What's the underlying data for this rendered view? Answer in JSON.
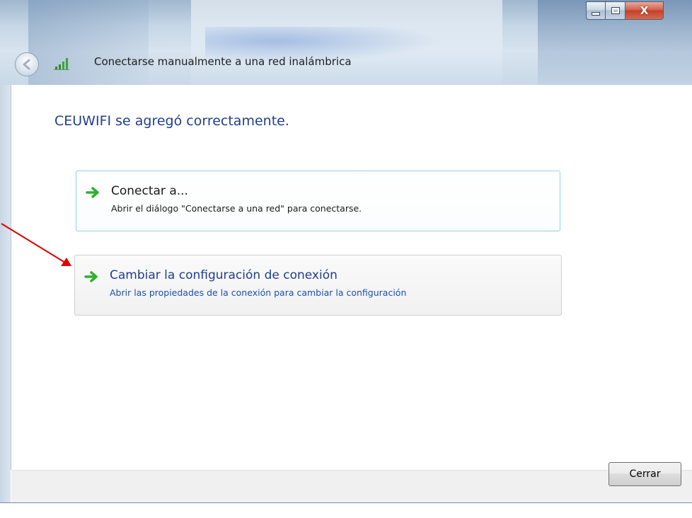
{
  "window": {
    "title": "Conectarse manualmente a una red inalámbrica",
    "caption_close": "X"
  },
  "main": {
    "heading": "CEUWIFI se agregó correctamente."
  },
  "options": [
    {
      "title": "Conectar a...",
      "description": "Abrir el diálogo \"Conectarse a una red\" para conectarse."
    },
    {
      "title": "Cambiar la configuración de conexión",
      "description": "Abrir las propiedades de la conexión para cambiar la configuración"
    }
  ],
  "footer": {
    "close_label": "Cerrar"
  },
  "colors": {
    "heading_blue": "#1e3f8f",
    "link_blue": "#1e4fa8",
    "arrow_green": "#2fb12f",
    "annotation_red": "#e00000"
  }
}
